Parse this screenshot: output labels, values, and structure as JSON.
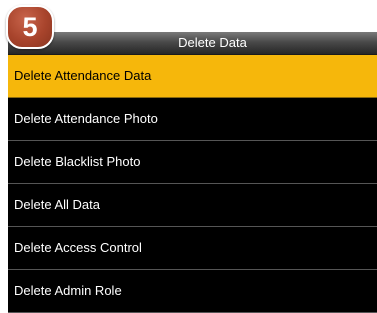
{
  "step_badge": {
    "number": "5",
    "color": "#a8442c"
  },
  "header": {
    "title": "Delete Data"
  },
  "menu": {
    "items": [
      {
        "label": "Delete Attendance Data",
        "selected": true
      },
      {
        "label": "Delete Attendance Photo",
        "selected": false
      },
      {
        "label": "Delete Blacklist Photo",
        "selected": false
      },
      {
        "label": "Delete All Data",
        "selected": false
      },
      {
        "label": "Delete Access Control",
        "selected": false
      },
      {
        "label": "Delete Admin Role",
        "selected": false
      }
    ]
  },
  "colors": {
    "selected_background": "#f6b70b",
    "screen_background": "#000000",
    "text": "#ffffff"
  }
}
